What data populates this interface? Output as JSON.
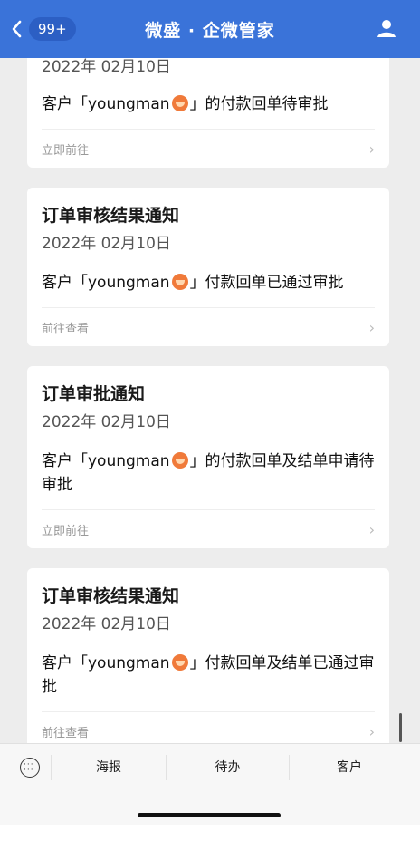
{
  "header": {
    "back_badge": "99+",
    "title": "微盛 · 企微管家"
  },
  "cards": [
    {
      "title": "",
      "date": "2022年 02月10日",
      "msg_prefix": "客户「youngman",
      "msg_suffix": "」的付款回单待审批",
      "link": "立即前往"
    },
    {
      "title": "订单审核结果通知",
      "date": "2022年 02月10日",
      "msg_prefix": "客户「youngman",
      "msg_suffix": "」付款回单已通过审批",
      "link": "前往查看"
    },
    {
      "title": "订单审批通知",
      "date": "2022年 02月10日",
      "msg_prefix": "客户「youngman",
      "msg_suffix": "」的付款回单及结单申请待审批",
      "link": "立即前往"
    },
    {
      "title": "订单审核结果通知",
      "date": "2022年 02月10日",
      "msg_prefix": "客户「youngman",
      "msg_suffix": "」付款回单及结单已通过审批",
      "link": "前往查看"
    }
  ],
  "tabbar": {
    "tabs": [
      "海报",
      "待办",
      "客户"
    ]
  },
  "icons": {
    "back": "chevron-left-icon",
    "profile": "user-icon",
    "keyboard": "keyboard-icon",
    "emoji": "face-emoji-icon",
    "chevron": "chevron-right-icon"
  },
  "colors": {
    "header": "#3a73d9",
    "badge": "#2c5fc4",
    "background": "#ededed"
  }
}
